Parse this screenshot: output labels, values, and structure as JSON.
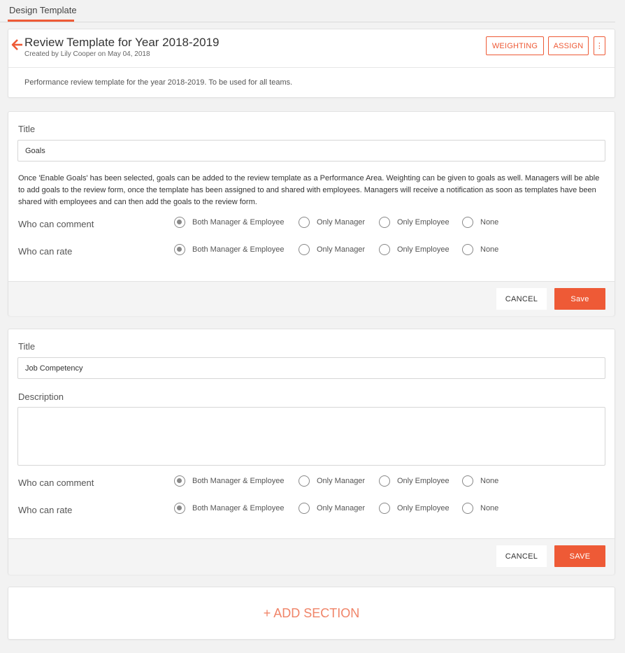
{
  "tabs": [
    {
      "label": "Design Template",
      "active": true
    }
  ],
  "accent_color": "#ee5a36",
  "header": {
    "title": "Review Template for Year 2018-2019",
    "created_by": "Created by Lily Cooper on May 04, 2018",
    "buttons": {
      "weighting": "WEIGHTING",
      "assign": "ASSIGN",
      "more": "⋮"
    },
    "description": "Performance review template for the year 2018-2019. To be used for all teams."
  },
  "radio_options": [
    "Both Manager & Employee",
    "Only Manager",
    "Only Employee",
    "None"
  ],
  "sections": [
    {
      "title_label": "Title",
      "title_value": "Goals",
      "info": "Once 'Enable Goals' has been selected, goals can be added to the review template as a Performance Area. Weighting can be given to goals as well. Managers will be able to add goals to the review form, once the template has been assigned to and shared with employees. Managers will receive a notification as soon as templates have been shared with employees and can then add the goals to the review form.",
      "comment_label": "Who can comment",
      "comment_selected": "Both Manager & Employee",
      "rate_label": "Who can rate",
      "rate_selected": "Both Manager & Employee",
      "cancel_label": "CANCEL",
      "save_label": "Save"
    },
    {
      "title_label": "Title",
      "title_value": "Job Competency",
      "description_label": "Description",
      "description_value": "",
      "comment_label": "Who can comment",
      "comment_selected": "Both Manager & Employee",
      "rate_label": "Who can rate",
      "rate_selected": "Both Manager & Employee",
      "cancel_label": "CANCEL",
      "save_label": "SAVE"
    }
  ],
  "add_section_label": "+ ADD SECTION"
}
